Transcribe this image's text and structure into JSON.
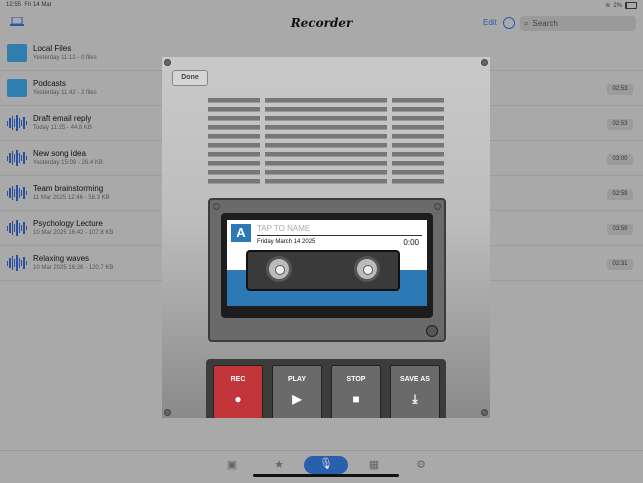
{
  "status": {
    "time": "12:55",
    "date": "Fri 14 Mar",
    "battery": "2%"
  },
  "header": {
    "title": "Recorder",
    "edit": "Edit",
    "search_placeholder": "Search"
  },
  "list": [
    {
      "name": "Local Files",
      "meta": "Yesterday 11:12 - 0 files",
      "type": "folder",
      "duration": ""
    },
    {
      "name": "Podcasts",
      "meta": "Yesterday 11:42 - 2 files",
      "type": "folder",
      "duration": "02:53"
    },
    {
      "name": "Draft email reply",
      "meta": "Today 11:25 - 44.8 KB",
      "type": "audio",
      "duration": "02:53"
    },
    {
      "name": "New song idea",
      "meta": "Yesterday 15:09 - 26.4 KB",
      "type": "audio",
      "duration": "03:00"
    },
    {
      "name": "Team brainstorming",
      "meta": "11 Mar 2025 12:46 - 58.3 KB",
      "type": "audio",
      "duration": "02:59"
    },
    {
      "name": "Psychology Lecture",
      "meta": "10 Mar 2025 16:42 - 107.8 KB",
      "type": "audio",
      "duration": "03:59"
    },
    {
      "name": "Relaxing waves",
      "meta": "10 Mar 2025 16:26 - 120.7 KB",
      "type": "audio",
      "duration": "02:31"
    }
  ],
  "modal": {
    "done": "Done",
    "badge": "A",
    "tap_to_name": "TAP TO NAME",
    "date": "Friday March 14 2025",
    "time": "0:00",
    "buttons": [
      {
        "label": "REC",
        "symbol": "●",
        "color": "#c0343a"
      },
      {
        "label": "PLAY",
        "symbol": "▶",
        "color": "#6a6a6a"
      },
      {
        "label": "STOP",
        "symbol": "■",
        "color": "#6a6a6a"
      },
      {
        "label": "SAVE AS",
        "symbol": "⤓",
        "color": "#6a6a6a"
      }
    ]
  },
  "tabs": [
    {
      "icon": "files-icon",
      "glyph": "▣"
    },
    {
      "icon": "star-icon",
      "glyph": "★"
    },
    {
      "icon": "microphone-icon",
      "glyph": "🎙"
    },
    {
      "icon": "grid-plus-icon",
      "glyph": "▦"
    },
    {
      "icon": "settings-icon",
      "glyph": "⚙"
    }
  ]
}
